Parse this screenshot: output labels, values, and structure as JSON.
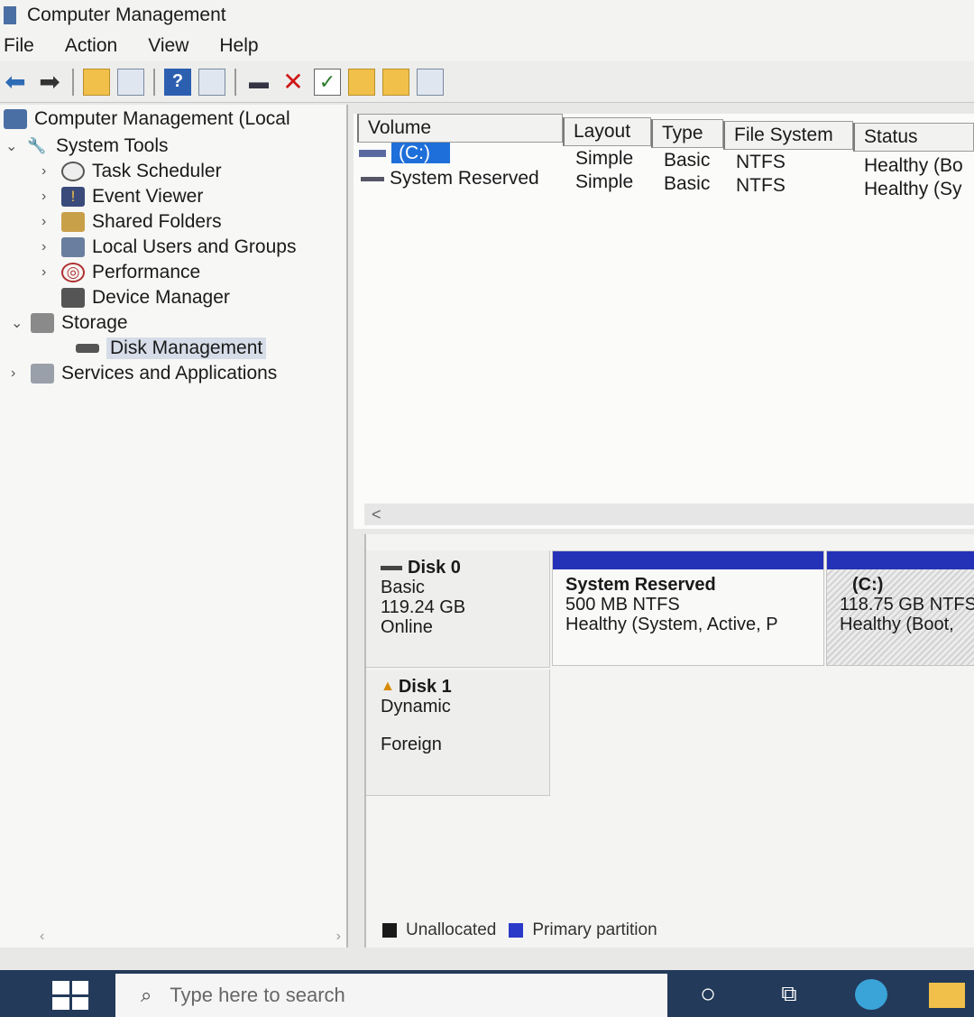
{
  "window": {
    "title": "Computer Management"
  },
  "menu": [
    "File",
    "Action",
    "View",
    "Help"
  ],
  "toolbar": {
    "buttons": [
      "back-arrow-icon",
      "forward-arrow-icon",
      "up-folder-icon",
      "show-hide-tree-icon",
      "help-icon",
      "action-pane-icon",
      "connect-icon",
      "delete-icon",
      "check-icon",
      "folder-up-icon",
      "folder-search-icon",
      "properties-icon"
    ]
  },
  "tree": {
    "root": "Computer Management (Local",
    "system_tools": "System Tools",
    "task_scheduler": "Task Scheduler",
    "event_viewer": "Event Viewer",
    "shared_folders": "Shared Folders",
    "local_users": "Local Users and Groups",
    "performance": "Performance",
    "device_manager": "Device Manager",
    "storage": "Storage",
    "disk_management": "Disk Management",
    "services": "Services and Applications"
  },
  "volume_list": {
    "columns": [
      "Volume",
      "Layout",
      "Type",
      "File System",
      "Status"
    ],
    "rows": [
      {
        "volume": "(C:)",
        "layout": "Simple",
        "type": "Basic",
        "fs": "NTFS",
        "status": "Healthy (Bo"
      },
      {
        "volume": "System Reserved",
        "layout": "Simple",
        "type": "Basic",
        "fs": "NTFS",
        "status": "Healthy (Sy"
      }
    ],
    "scroll_left": "<"
  },
  "disks": {
    "disk0": {
      "name": "Disk 0",
      "type": "Basic",
      "size": "119.24 GB",
      "state": "Online"
    },
    "disk0_part1": {
      "name": "System Reserved",
      "size": "500 MB NTFS",
      "status": "Healthy (System, Active, P"
    },
    "disk0_part2": {
      "name": "(C:)",
      "size": "118.75 GB NTFS",
      "status": "Healthy (Boot,"
    },
    "disk1": {
      "name": "Disk 1",
      "type": "Dynamic",
      "state": "Foreign"
    }
  },
  "legend": {
    "unallocated": "Unallocated",
    "primary": "Primary partition"
  },
  "colors": {
    "unallocated": "#1a1a1a",
    "primary": "#2a3ac8",
    "taskbar": "#233a5a",
    "selection": "#1e6fd9"
  },
  "taskbar": {
    "search_placeholder": "Type here to search"
  }
}
